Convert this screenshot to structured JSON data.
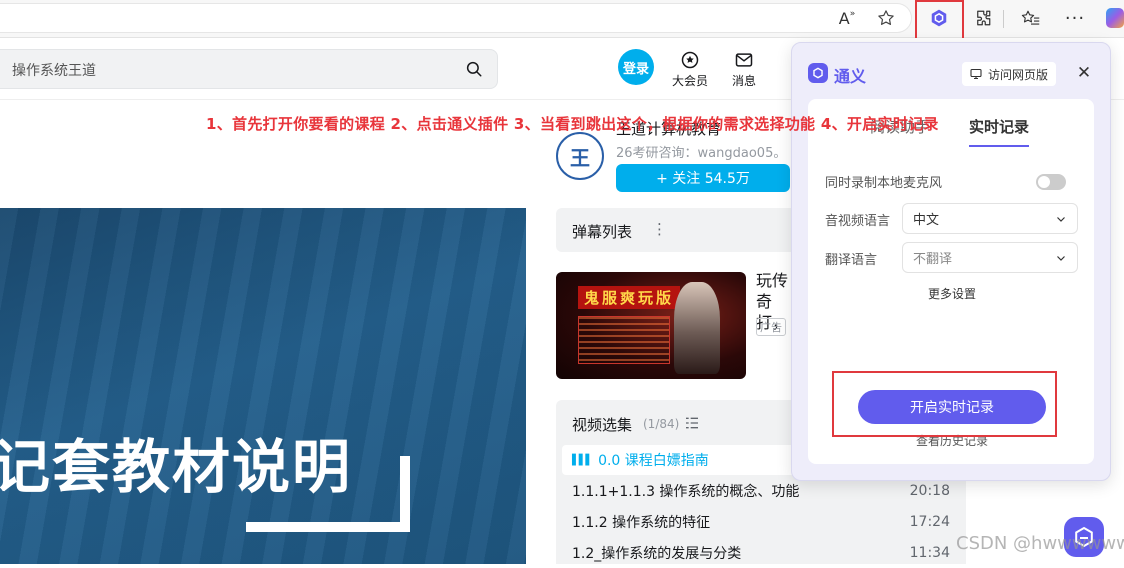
{
  "browser": {
    "toolbar": {
      "read_aloud_label": "A",
      "read_aloud_sup": "»"
    }
  },
  "site": {
    "search": {
      "placeholder": "操作系统王道"
    },
    "login_label": "登录",
    "nav": [
      {
        "label": "大会员",
        "icon": "vip-icon"
      },
      {
        "label": "消息",
        "icon": "message-icon"
      }
    ]
  },
  "annotation": {
    "instruction": "1、首先打开你要看的课程 2、点击通义插件 3、当看到跳出这个，根据你的需求选择功能 4、开启实时记录"
  },
  "video": {
    "title_text": "记套教材说明"
  },
  "uploader": {
    "name": "王道计算机教育",
    "desc": "26考研咨询：wangdao05。",
    "avatar_text": "王",
    "follow_label": "+ 关注 54.5万"
  },
  "danmaku": {
    "title": "弹幕列表",
    "more": "⋮"
  },
  "ad": {
    "banner": "鬼服爽玩版",
    "text": "玩传奇打，",
    "badge": "广告"
  },
  "playlist": {
    "title": "视频选集",
    "count": "(1/84)",
    "episodes": [
      {
        "title": "0.0 课程白嫖指南",
        "duration": "",
        "active": true
      },
      {
        "title": "1.1.1+1.1.3 操作系统的概念、功能",
        "duration": "20:18",
        "active": false
      },
      {
        "title": "1.1.2 操作系统的特征",
        "duration": "17:24",
        "active": false
      },
      {
        "title": "1.2_操作系统的发展与分类",
        "duration": "11:34",
        "active": false
      }
    ]
  },
  "tongyi": {
    "brand": "通义",
    "visit_page": "访问网页版",
    "close": "✕",
    "tabs": {
      "reading": "阅读助手",
      "realtime": "实时记录"
    },
    "record_mic_label": "同时录制本地麦克风",
    "record_mic_on": false,
    "av_language_label": "音视频语言",
    "av_language_value": "中文",
    "translate_label": "翻译语言",
    "translate_value": "不翻译",
    "more_settings": "更多设置",
    "start_button": "开启实时记录",
    "history_link": "查看历史记录",
    "accent_color": "#615ced"
  },
  "highlight_color": "#e0393e",
  "watermark": "CSDN @hwwwwww"
}
